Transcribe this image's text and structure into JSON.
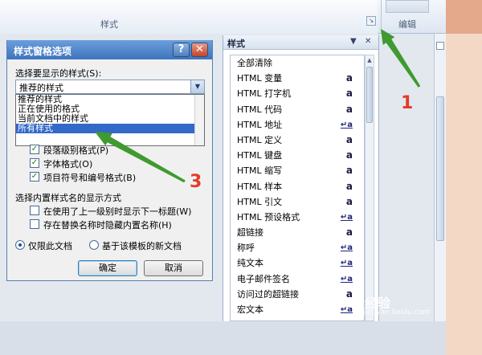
{
  "ribbon": {
    "styles_group_label": "样式",
    "edit_group_label": "编辑"
  },
  "styles_pane": {
    "title": "样式",
    "items": [
      {
        "label": "全部清除",
        "glyph": ""
      },
      {
        "label": "HTML 变量",
        "glyph": "a"
      },
      {
        "label": "HTML 打字机",
        "glyph": "a"
      },
      {
        "label": "HTML 代码",
        "glyph": "a"
      },
      {
        "label": "HTML 地址",
        "glyph": "↵a"
      },
      {
        "label": "HTML 定义",
        "glyph": "a"
      },
      {
        "label": "HTML 键盘",
        "glyph": "a"
      },
      {
        "label": "HTML 缩写",
        "glyph": "a"
      },
      {
        "label": "HTML 样本",
        "glyph": "a"
      },
      {
        "label": "HTML 引文",
        "glyph": "a"
      },
      {
        "label": "HTML 预设格式",
        "glyph": "↵a"
      },
      {
        "label": "超链接",
        "glyph": "a"
      },
      {
        "label": "称呼",
        "glyph": "↵a"
      },
      {
        "label": "纯文本",
        "glyph": "↵a"
      },
      {
        "label": "电子邮件签名",
        "glyph": "↵a"
      },
      {
        "label": "访问过的超链接",
        "glyph": "a"
      },
      {
        "label": "宏文本",
        "glyph": "↵a"
      }
    ]
  },
  "dialog": {
    "title": "样式窗格选项",
    "select_label": "选择要显示的样式(S):",
    "selected_value": "推荐的样式",
    "dropdown_options": [
      "推荐的样式",
      "正在使用的格式",
      "当前文档中的样式",
      "所有样式"
    ],
    "checkboxes": [
      {
        "label": "段落级别格式(P)",
        "checked": true
      },
      {
        "label": "字体格式(O)",
        "checked": true
      },
      {
        "label": "项目符号和编号格式(B)",
        "checked": true
      }
    ],
    "builtin_label": "选择内置样式名的显示方式",
    "builtin_options": [
      {
        "label": "在使用了上一级别时显示下一标题(W)",
        "checked": false
      },
      {
        "label": "存在替换名称时隐藏内置名称(H)",
        "checked": false
      }
    ],
    "radios": [
      {
        "label": "仅限此文档",
        "selected": true
      },
      {
        "label": "基于该模板的新文档",
        "selected": false
      }
    ],
    "ok_label": "确定",
    "cancel_label": "取消"
  },
  "annotations": {
    "step1": "1",
    "step3": "3",
    "arrow_color": "#3f9a2f"
  },
  "watermark": {
    "brand": "Bai 经验",
    "url": "jingyan.baidu.com"
  }
}
